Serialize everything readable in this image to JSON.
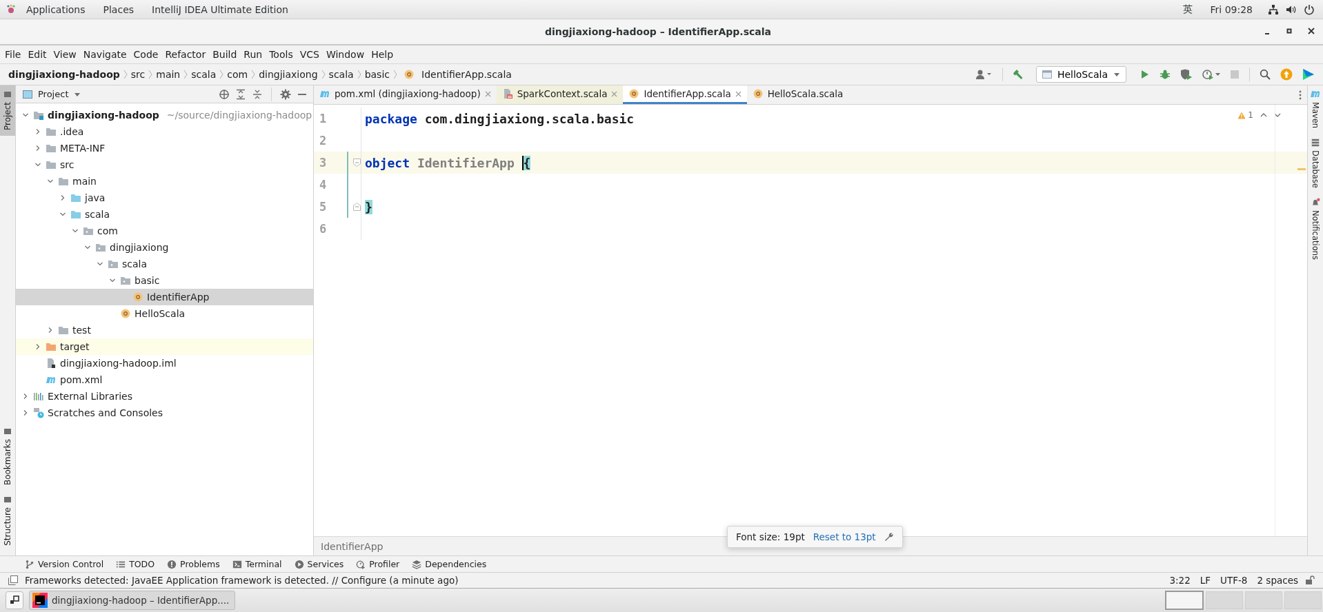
{
  "desktop_bar": {
    "menus": [
      "Applications",
      "Places",
      "IntelliJ IDEA Ultimate Edition"
    ],
    "input_method": "英",
    "clock": "Fri 09:28"
  },
  "window": {
    "title": "dingjiaxiong-hadoop – IdentifierApp.scala"
  },
  "menu_bar": [
    "File",
    "Edit",
    "View",
    "Navigate",
    "Code",
    "Refactor",
    "Build",
    "Run",
    "Tools",
    "VCS",
    "Window",
    "Help"
  ],
  "breadcrumbs": [
    {
      "label": "dingjiaxiong-hadoop",
      "kind": "project"
    },
    {
      "label": "src",
      "kind": "folder"
    },
    {
      "label": "main",
      "kind": "folder"
    },
    {
      "label": "scala",
      "kind": "folder"
    },
    {
      "label": "com",
      "kind": "folder"
    },
    {
      "label": "dingjiaxiong",
      "kind": "folder"
    },
    {
      "label": "scala",
      "kind": "folder"
    },
    {
      "label": "basic",
      "kind": "folder"
    },
    {
      "label": "IdentifierApp.scala",
      "kind": "object"
    }
  ],
  "run_config": "HelloScala",
  "left_stripe": [
    {
      "label": "Project",
      "selected": true,
      "kind": "top"
    },
    {
      "label": "Bookmarks",
      "selected": false,
      "kind": "bottom"
    },
    {
      "label": "Structure",
      "selected": false,
      "kind": "bottom"
    }
  ],
  "project_panel": {
    "title": "Project",
    "tree": [
      {
        "label": "dingjiaxiong-hadoop",
        "path": "~/source/dingjiaxiong-hadoop",
        "kind": "module",
        "expanded": true,
        "selected": false,
        "children": [
          {
            "label": ".idea",
            "kind": "folder",
            "expanded": false,
            "selected": false
          },
          {
            "label": "META-INF",
            "kind": "folder",
            "expanded": false,
            "selected": false
          },
          {
            "label": "src",
            "kind": "folder",
            "expanded": true,
            "selected": false,
            "children": [
              {
                "label": "main",
                "kind": "folder",
                "expanded": true,
                "selected": false,
                "children": [
                  {
                    "label": "java",
                    "kind": "source-folder",
                    "expanded": false,
                    "selected": false
                  },
                  {
                    "label": "scala",
                    "kind": "source-folder",
                    "expanded": true,
                    "selected": false,
                    "children": [
                      {
                        "label": "com",
                        "kind": "package",
                        "expanded": true,
                        "selected": false,
                        "children": [
                          {
                            "label": "dingjiaxiong",
                            "kind": "package",
                            "expanded": true,
                            "selected": false,
                            "children": [
                              {
                                "label": "scala",
                                "kind": "package",
                                "expanded": true,
                                "selected": false,
                                "children": [
                                  {
                                    "label": "basic",
                                    "kind": "package",
                                    "expanded": true,
                                    "selected": false,
                                    "children": [
                                      {
                                        "label": "IdentifierApp",
                                        "kind": "object",
                                        "selected": true
                                      }
                                    ]
                                  },
                                  {
                                    "label": "HelloScala",
                                    "kind": "object",
                                    "selected": false
                                  }
                                ]
                              }
                            ]
                          }
                        ]
                      }
                    ]
                  }
                ]
              },
              {
                "label": "test",
                "kind": "folder",
                "expanded": false,
                "selected": false
              }
            ]
          },
          {
            "label": "target",
            "kind": "excluded-folder",
            "expanded": false,
            "selected": false
          },
          {
            "label": "dingjiaxiong-hadoop.iml",
            "kind": "iml",
            "selected": false
          },
          {
            "label": "pom.xml",
            "kind": "maven",
            "selected": false
          }
        ]
      },
      {
        "label": "External Libraries",
        "kind": "libraries",
        "expanded": false,
        "selected": false
      },
      {
        "label": "Scratches and Consoles",
        "kind": "scratches",
        "expanded": false,
        "selected": false
      }
    ]
  },
  "editor": {
    "tabs": [
      {
        "label": "pom.xml (dingjiaxiong-hadoop)",
        "kind": "maven",
        "selected": false,
        "read_only": false
      },
      {
        "label": "SparkContext.scala",
        "kind": "library-class",
        "selected": false,
        "read_only": true
      },
      {
        "label": "IdentifierApp.scala",
        "kind": "object",
        "selected": true,
        "read_only": false
      },
      {
        "label": "HelloScala.scala",
        "kind": "object",
        "selected": false,
        "read_only": false
      }
    ],
    "warnings": "1",
    "lines": [
      {
        "number": "1",
        "kind": "plain",
        "current": false,
        "changed": false,
        "tokens": [
          {
            "text": "package",
            "kind": "keyword"
          },
          {
            "text": "com.dingjiaxiong.scala.basic",
            "kind": "plain"
          }
        ]
      },
      {
        "number": "2",
        "kind": "plain",
        "current": false,
        "changed": false
      },
      {
        "number": "3",
        "kind": "fold-start",
        "current": true,
        "changed": true,
        "tokens": [
          {
            "text": "object",
            "kind": "keyword"
          },
          {
            "text": "IdentifierApp",
            "kind": "unused"
          },
          {
            "text": "{",
            "kind": "brace",
            "matched": true,
            "caret": true
          }
        ]
      },
      {
        "number": "4",
        "kind": "plain",
        "current": false,
        "changed": true
      },
      {
        "number": "5",
        "kind": "fold-end",
        "current": false,
        "changed": true,
        "tokens": [
          {
            "text": "}",
            "kind": "brace",
            "matched": true,
            "caret": false
          }
        ]
      },
      {
        "number": "6",
        "kind": "plain",
        "current": false,
        "changed": false
      }
    ],
    "breadcrumb": "IdentifierApp"
  },
  "font_popup": {
    "text": "Font size: 19pt",
    "link": "Reset to 13pt"
  },
  "right_stripe": [
    {
      "label": "Maven",
      "kind": "maven"
    },
    {
      "label": "Database",
      "kind": "database"
    },
    {
      "label": "Notifications",
      "kind": "bell"
    }
  ],
  "tool_windows": [
    {
      "label": "Version Control",
      "kind": "branch"
    },
    {
      "label": "TODO",
      "kind": "list"
    },
    {
      "label": "Problems",
      "kind": "alert"
    },
    {
      "label": "Terminal",
      "kind": "terminal"
    },
    {
      "label": "Services",
      "kind": "play"
    },
    {
      "label": "Profiler",
      "kind": "profiler"
    },
    {
      "label": "Dependencies",
      "kind": "layers"
    }
  ],
  "status_bar": {
    "message": "Frameworks detected: JavaEE Application framework is detected. // Configure (a minute ago)",
    "items": [
      "3:22",
      "LF",
      "UTF-8",
      "2 spaces"
    ]
  },
  "taskbar": {
    "task": "dingjiaxiong-hadoop – IdentifierApp....",
    "workspaces": [
      {
        "selected": true
      },
      {
        "selected": false
      },
      {
        "selected": false
      },
      {
        "selected": false
      }
    ]
  }
}
